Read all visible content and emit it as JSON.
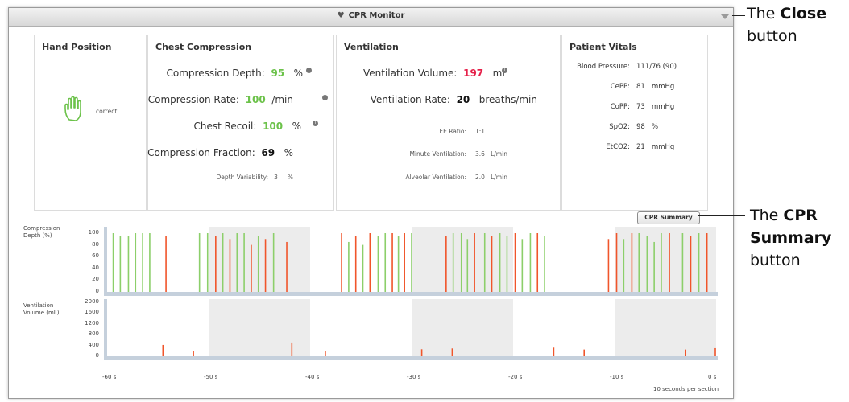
{
  "window": {
    "title": "CPR Monitor"
  },
  "hand_position": {
    "heading": "Hand Position",
    "status": "correct"
  },
  "chest_compression": {
    "heading": "Chest Compression",
    "depth": {
      "label": "Compression Depth:",
      "value": "95",
      "unit": "%"
    },
    "rate": {
      "label": "Compression Rate:",
      "value": "100",
      "unit": "/min"
    },
    "recoil": {
      "label": "Chest Recoil:",
      "value": "100",
      "unit": "%"
    },
    "fraction": {
      "label": "Compression Fraction:",
      "value": "69",
      "unit": "%"
    },
    "variability": {
      "label": "Depth Variability:",
      "value": "3",
      "unit": "%"
    }
  },
  "ventilation": {
    "heading": "Ventilation",
    "volume": {
      "label": "Ventilation Volume:",
      "value": "197",
      "unit": "mL"
    },
    "rate": {
      "label": "Ventilation Rate:",
      "value": "20",
      "unit": "breaths/min"
    },
    "ie_ratio": {
      "label": "I:E Ratio:",
      "value": "1:1"
    },
    "minute": {
      "label": "Minute Ventilation:",
      "value": "3.6",
      "unit": "L/min"
    },
    "alveolar": {
      "label": "Alveolar Ventilation:",
      "value": "2.0",
      "unit": "L/min"
    }
  },
  "vitals": {
    "heading": "Patient Vitals",
    "bp": {
      "label": "Blood Pressure:",
      "value": "111/76 (90)"
    },
    "cepp": {
      "label": "CePP:",
      "value": "81",
      "unit": "mmHg"
    },
    "copp": {
      "label": "CoPP:",
      "value": "73",
      "unit": "mmHg"
    },
    "spo2": {
      "label": "SpO2:",
      "value": "98",
      "unit": "%"
    },
    "etco2": {
      "label": "EtCO2:",
      "value": "21",
      "unit": "mmHg"
    }
  },
  "cpr_summary_label": "CPR Summary",
  "charts": {
    "compression_label_1": "Compression",
    "compression_label_2": "Depth (%)",
    "ventilation_label_1": "Ventilation",
    "ventilation_label_2": "Volume (mL)",
    "compression_ticks": [
      "100",
      "80",
      "60",
      "40",
      "20",
      "0"
    ],
    "ventilation_ticks": [
      "2000",
      "1600",
      "1200",
      "800",
      "400",
      "0"
    ],
    "x_ticks": [
      "-60 s",
      "-50 s",
      "-40 s",
      "-30 s",
      "-20 s",
      "-10 s",
      "0 s"
    ],
    "footer": "10 seconds per section",
    "colors": {
      "good": "#8ccf6a",
      "bad": "#f0552b",
      "shade": "#ececec",
      "axis": "#c5d0dc"
    }
  },
  "chart_data": [
    {
      "type": "bar",
      "xlabel": "",
      "ylabel": "Compression Depth (%)",
      "xlim": [
        -60,
        0
      ],
      "ylim": [
        0,
        100
      ],
      "series": [
        {
          "name": "",
          "x": [
            -59.4,
            -58.7,
            -57.9,
            -57.2,
            -56.5,
            -55.8,
            -54.2,
            -50.9,
            -50.1,
            -49.3,
            -48.6,
            -47.9,
            -47.2,
            -46.5,
            -45.8,
            -45.1,
            -44.4,
            -43.6,
            -42.3,
            -36.9,
            -36.2,
            -35.5,
            -34.8,
            -34.1,
            -33.3,
            -32.6,
            -31.9,
            -31.3,
            -30.7,
            -30.0,
            -26.6,
            -25.9,
            -25.1,
            -24.5,
            -23.8,
            -22.8,
            -22.1,
            -21.3,
            -20.6,
            -19.8,
            -19.1,
            -18.3,
            -17.6,
            -16.9,
            -10.6,
            -9.8,
            -9.1,
            -8.3,
            -7.6,
            -6.8,
            -6.1,
            -5.4,
            -4.6,
            -3.3,
            -2.5,
            -1.7,
            -0.9
          ],
          "values": [
            100,
            95,
            95,
            100,
            100,
            100,
            95,
            100,
            100,
            95,
            100,
            90,
            100,
            100,
            80,
            95,
            90,
            100,
            85,
            100,
            85,
            95,
            80,
            100,
            95,
            100,
            100,
            95,
            100,
            100,
            95,
            100,
            100,
            90,
            100,
            100,
            95,
            100,
            95,
            100,
            90,
            100,
            100,
            95,
            90,
            100,
            90,
            100,
            100,
            95,
            85,
            100,
            100,
            100,
            95,
            100,
            100
          ],
          "status": [
            "good",
            "good",
            "good",
            "good",
            "good",
            "good",
            "bad",
            "good",
            "good",
            "bad",
            "good",
            "bad",
            "good",
            "good",
            "bad",
            "good",
            "bad",
            "good",
            "bad",
            "bad",
            "good",
            "bad",
            "good",
            "bad",
            "good",
            "good",
            "bad",
            "good",
            "bad",
            "good",
            "bad",
            "good",
            "good",
            "good",
            "bad",
            "good",
            "bad",
            "good",
            "good",
            "bad",
            "good",
            "good",
            "bad",
            "good",
            "bad",
            "bad",
            "good",
            "bad",
            "good",
            "good",
            "good",
            "good",
            "bad",
            "good",
            "bad",
            "good",
            "bad"
          ]
        }
      ]
    },
    {
      "type": "bar",
      "xlabel": "",
      "ylabel": "Ventilation Volume (mL)",
      "xlim": [
        -60,
        0
      ],
      "ylim": [
        0,
        2000
      ],
      "series": [
        {
          "name": "",
          "x": [
            -54.5,
            -51.5,
            -41.8,
            -38.5,
            -29.0,
            -26.0,
            -16.0,
            -13.0,
            -3.0,
            0.0
          ],
          "values": [
            420,
            180,
            510,
            190,
            260,
            290,
            320,
            250,
            250,
            300
          ]
        }
      ]
    }
  ]
}
